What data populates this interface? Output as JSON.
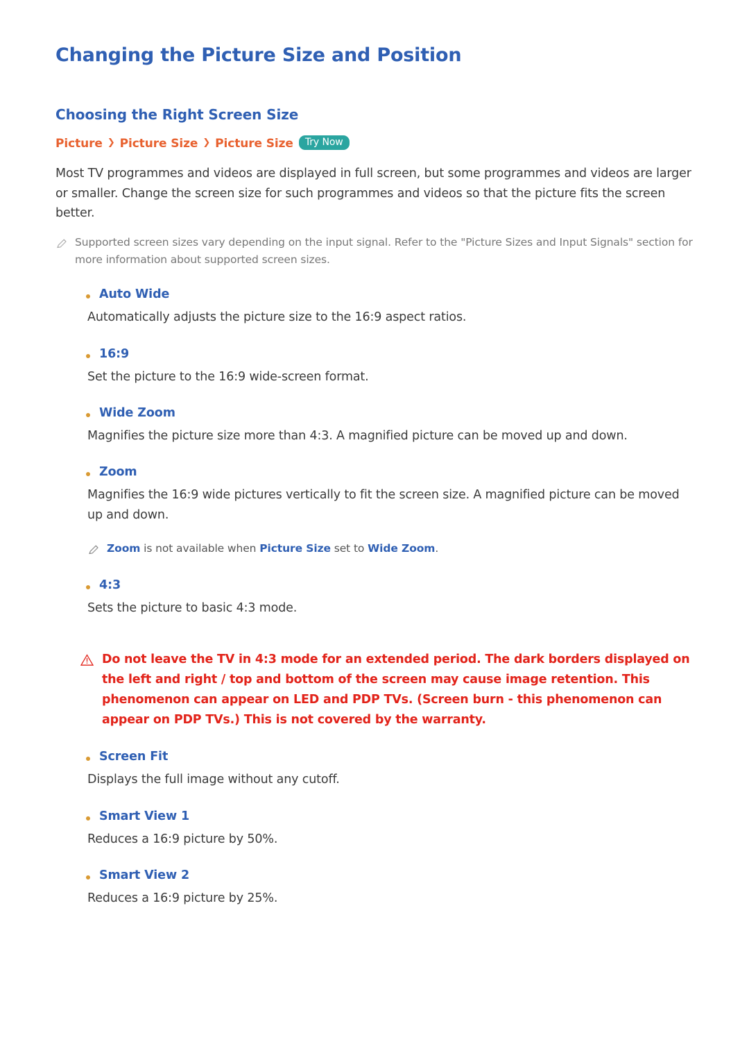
{
  "document": {
    "title": "Changing the Picture Size and Position",
    "section_title": "Choosing the Right Screen Size",
    "breadcrumb": {
      "items": [
        "Picture",
        "Picture Size",
        "Picture Size"
      ],
      "separator": "❯",
      "try_now_label": "Try Now"
    },
    "intro": "Most TV programmes and videos are displayed in full screen, but some programmes and videos are larger or smaller. Change the screen size for such programmes and videos so that the picture fits the screen better.",
    "note": "Supported screen sizes vary depending on the input signal. Refer to the \"Picture Sizes and Input Signals\" section for more information about supported screen sizes.",
    "options": [
      {
        "label": "Auto Wide",
        "description": "Automatically adjusts the picture size to the 16:9 aspect ratios."
      },
      {
        "label": "16:9",
        "description": "Set the picture to the 16:9 wide-screen format."
      },
      {
        "label": "Wide Zoom",
        "description": "Magnifies the picture size more than 4:3. A magnified picture can be moved up and down."
      },
      {
        "label": "Zoom",
        "description": "Magnifies the 16:9 wide pictures vertically to fit the screen size. A magnified picture can be moved up and down."
      },
      {
        "label": "4:3",
        "description": "Sets the picture to basic 4:3 mode."
      },
      {
        "label": "Screen Fit",
        "description": "Displays the full image without any cutoff."
      },
      {
        "label": "Smart View 1",
        "description": "Reduces a 16:9 picture by 50%."
      },
      {
        "label": "Smart View 2",
        "description": "Reduces a 16:9 picture by 25%."
      }
    ],
    "zoom_note": {
      "part1": "Zoom",
      "part2": " is not available when ",
      "part3": "Picture Size",
      "part4": " set to ",
      "part5": "Wide Zoom",
      "part6": "."
    },
    "warning": "Do not leave the TV in 4:3 mode for an extended period. The dark borders displayed on the left and right / top and bottom of the screen may cause image retention. This phenomenon can appear on LED and PDP TVs. (Screen burn - this phenomenon can appear on PDP TVs.) This is not covered by the warranty.",
    "colors": {
      "heading": "#2f5fb3",
      "breadcrumb": "#e8612f",
      "try_now_bg": "#2aa5a0",
      "warning": "#e2231a",
      "bullet": "#d99a33"
    }
  }
}
